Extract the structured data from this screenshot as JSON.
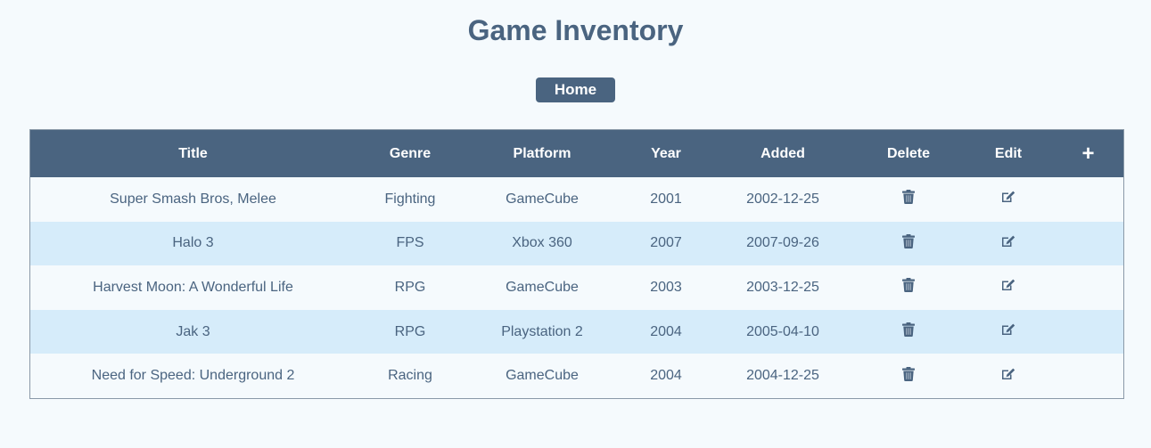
{
  "page": {
    "title": "Game Inventory"
  },
  "nav": {
    "home_label": "Home"
  },
  "table": {
    "headers": {
      "title": "Title",
      "genre": "Genre",
      "platform": "Platform",
      "year": "Year",
      "added": "Added",
      "delete": "Delete",
      "edit": "Edit",
      "add": "+"
    },
    "rows": [
      {
        "title": "Super Smash Bros, Melee",
        "genre": "Fighting",
        "platform": "GameCube",
        "year": "2001",
        "added": "2002-12-25"
      },
      {
        "title": "Halo 3",
        "genre": "FPS",
        "platform": "Xbox 360",
        "year": "2007",
        "added": "2007-09-26"
      },
      {
        "title": "Harvest Moon: A Wonderful Life",
        "genre": "RPG",
        "platform": "GameCube",
        "year": "2003",
        "added": "2003-12-25"
      },
      {
        "title": "Jak 3",
        "genre": "RPG",
        "platform": "Playstation 2",
        "year": "2004",
        "added": "2005-04-10"
      },
      {
        "title": "Need for Speed: Underground 2",
        "genre": "Racing",
        "platform": "GameCube",
        "year": "2004",
        "added": "2004-12-25"
      }
    ]
  },
  "icons": {
    "delete": "trash-icon",
    "edit": "edit-icon",
    "add": "plus-icon"
  },
  "colors": {
    "primary": "#4a6480",
    "background": "#f5fafd",
    "row_alt": "#d6ecfa"
  }
}
